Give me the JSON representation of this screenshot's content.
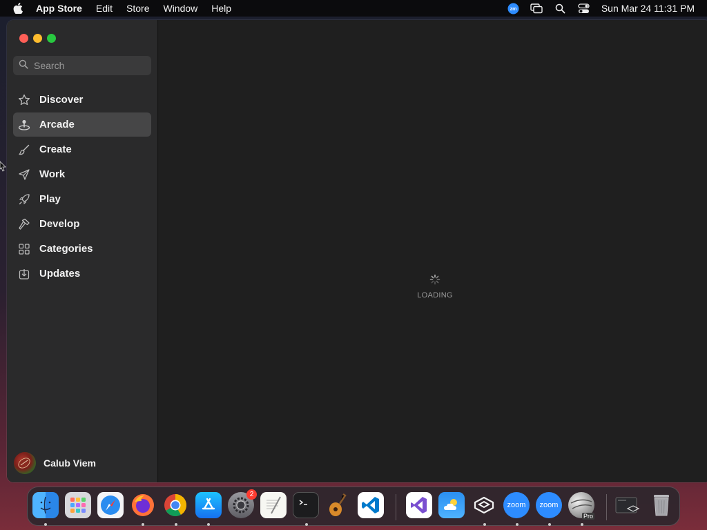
{
  "menubar": {
    "app_name": "App Store",
    "menus": [
      "Edit",
      "Store",
      "Window",
      "Help"
    ],
    "status_icons": [
      "zoom-status-icon",
      "screen-mirroring-icon",
      "spotlight-search-icon",
      "control-center-icon"
    ],
    "clock": "Sun Mar 24  11:31 PM"
  },
  "window": {
    "sidebar": {
      "search": {
        "placeholder": "Search",
        "value": ""
      },
      "items": [
        {
          "label": "Discover",
          "icon": "star-icon",
          "selected": false
        },
        {
          "label": "Arcade",
          "icon": "joystick-icon",
          "selected": true
        },
        {
          "label": "Create",
          "icon": "paintbrush-icon",
          "selected": false
        },
        {
          "label": "Work",
          "icon": "paper-plane-icon",
          "selected": false
        },
        {
          "label": "Play",
          "icon": "rocket-icon",
          "selected": false
        },
        {
          "label": "Develop",
          "icon": "hammer-icon",
          "selected": false
        },
        {
          "label": "Categories",
          "icon": "grid-icon",
          "selected": false
        },
        {
          "label": "Updates",
          "icon": "download-icon",
          "selected": false
        }
      ],
      "profile": {
        "name": "Calub Viem"
      }
    },
    "content": {
      "loading_label": "LOADING"
    }
  },
  "dock": {
    "apps": [
      {
        "name": "Finder",
        "running": true
      },
      {
        "name": "Launchpad",
        "running": false
      },
      {
        "name": "Safari",
        "running": false
      },
      {
        "name": "Firefox",
        "running": true
      },
      {
        "name": "Chrome",
        "running": true
      },
      {
        "name": "App Store",
        "running": true
      },
      {
        "name": "System Settings",
        "running": false,
        "badge": "2"
      },
      {
        "name": "TextEdit",
        "running": false
      },
      {
        "name": "Terminal",
        "running": true
      },
      {
        "name": "GarageBand",
        "running": false
      },
      {
        "name": "Visual Studio Code",
        "running": false
      },
      {
        "name": "Visual Studio",
        "running": false
      },
      {
        "name": "Weather",
        "running": false
      },
      {
        "name": "Unity Hub",
        "running": true
      },
      {
        "name": "Zoom",
        "running": true,
        "label": "zoom"
      },
      {
        "name": "Zoom",
        "running": true,
        "label": "zoom"
      },
      {
        "name": "Google Earth Pro",
        "running": true,
        "label": "Pro"
      },
      {
        "name": "Downloads",
        "running": false
      },
      {
        "name": "Trash",
        "running": false
      }
    ]
  },
  "colors": {
    "selected_row": "#464647",
    "sidebar_bg": "#2a2a2b",
    "content_bg": "#1f1f1f",
    "close": "#ff5f57",
    "minimize": "#febc2e",
    "zoom": "#28c840"
  }
}
